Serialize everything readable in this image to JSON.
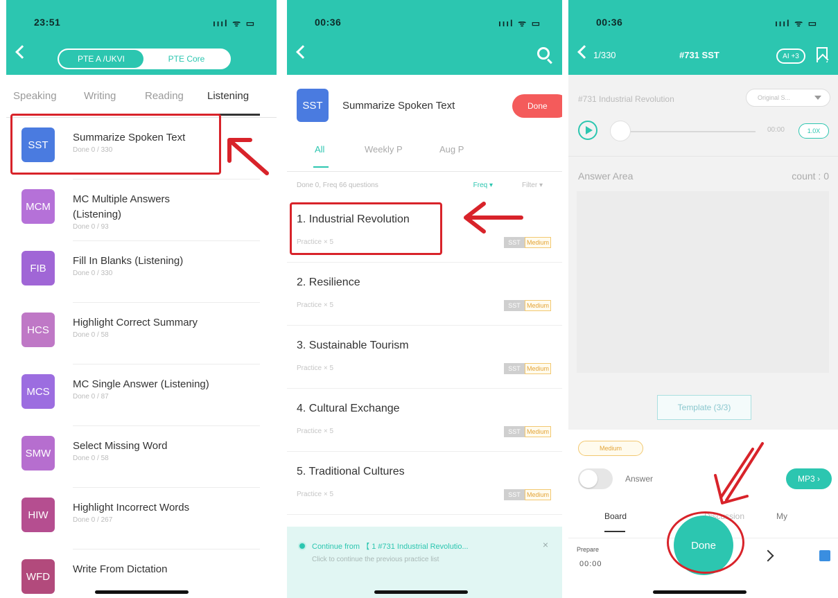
{
  "panel1": {
    "status": {
      "time": "23:51",
      "icons": "ıııl ᯤ ▭"
    },
    "segment": {
      "active": "PTE A /UKVI",
      "inactive": "PTE Core"
    },
    "tabs": [
      "Speaking",
      "Writing",
      "Reading",
      "Listening"
    ],
    "active_tab": "Listening",
    "items": [
      {
        "abbr": "SST",
        "color": "#4a7be0",
        "title": "Summarize Spoken Text",
        "sub": "Done 0 / 330"
      },
      {
        "abbr": "MCM",
        "color": "#b571d8",
        "title": "MC Multiple Answers (Listening)",
        "sub": "Done 0 / 93"
      },
      {
        "abbr": "FIB",
        "color": "#a066d6",
        "title": "Fill In Blanks (Listening)",
        "sub": "Done 0 / 330"
      },
      {
        "abbr": "HCS",
        "color": "#bf78c6",
        "title": "Highlight Correct Summary",
        "sub": "Done 0 / 58"
      },
      {
        "abbr": "MCS",
        "color": "#9c6de0",
        "title": "MC Single Answer (Listening)",
        "sub": "Done 0 / 87"
      },
      {
        "abbr": "SMW",
        "color": "#b66ecf",
        "title": "Select Missing Word",
        "sub": "Done 0 / 58"
      },
      {
        "abbr": "HIW",
        "color": "#b54e90",
        "title": "Highlight Incorrect Words",
        "sub": "Done 0 / 267"
      },
      {
        "abbr": "WFD",
        "color": "#b24a7c",
        "title": "Write From Dictation",
        "sub": ""
      }
    ]
  },
  "panel2": {
    "status": {
      "time": "00:36",
      "icons": "ıııl ᯤ ▭"
    },
    "header": {
      "icon": "SST",
      "title": "Summarize Spoken Text",
      "badge": "Done"
    },
    "subtabs": [
      "All",
      "Weekly P",
      "Aug P"
    ],
    "filter": {
      "left": "Done 0, Freq 66 questions",
      "mid": "Freq ▾",
      "right": "Filter ▾"
    },
    "items": [
      {
        "title": "1. Industrial Revolution",
        "sub": "Practice × 5",
        "tag1": "SST",
        "tag2": "Medium"
      },
      {
        "title": "2. Resilience",
        "sub": "Practice × 5",
        "tag1": "SST",
        "tag2": "Medium"
      },
      {
        "title": "3. Sustainable Tourism",
        "sub": "Practice × 5",
        "tag1": "SST",
        "tag2": "Medium"
      },
      {
        "title": "4. Cultural Exchange",
        "sub": "Practice × 5",
        "tag1": "SST",
        "tag2": "Medium"
      },
      {
        "title": "5. Traditional Cultures",
        "sub": "Practice × 5",
        "tag1": "SST",
        "tag2": "Medium"
      }
    ],
    "continue": {
      "text": "Continue from 【 1 #731 Industrial Revolutio...",
      "sub": "Click to continue the previous practice list",
      "close": "×"
    }
  },
  "panel3": {
    "status": {
      "time": "00:36",
      "icons": "ıııl ᯤ ▭"
    },
    "nav": {
      "count": "1/330",
      "title": "#731 SST",
      "pill": "AI +3"
    },
    "audio": {
      "title": "#731 Industrial Revolution",
      "select": "Original S...",
      "time": "00:00",
      "speed": "1.0X"
    },
    "answer": {
      "label": "Answer Area",
      "count": "count : 0"
    },
    "template": "Template (3/3)",
    "difficulty": "Medium",
    "answer_toggle": "Answer",
    "mp3": "MP3 ›",
    "bottom_tabs": [
      "Board",
      "Discussion",
      "My"
    ],
    "prepare": {
      "label": "Prepare",
      "value": "00:00"
    },
    "done": "Done"
  },
  "colors": {
    "primary": "#2cc6b0",
    "annotation": "#d8232a"
  }
}
